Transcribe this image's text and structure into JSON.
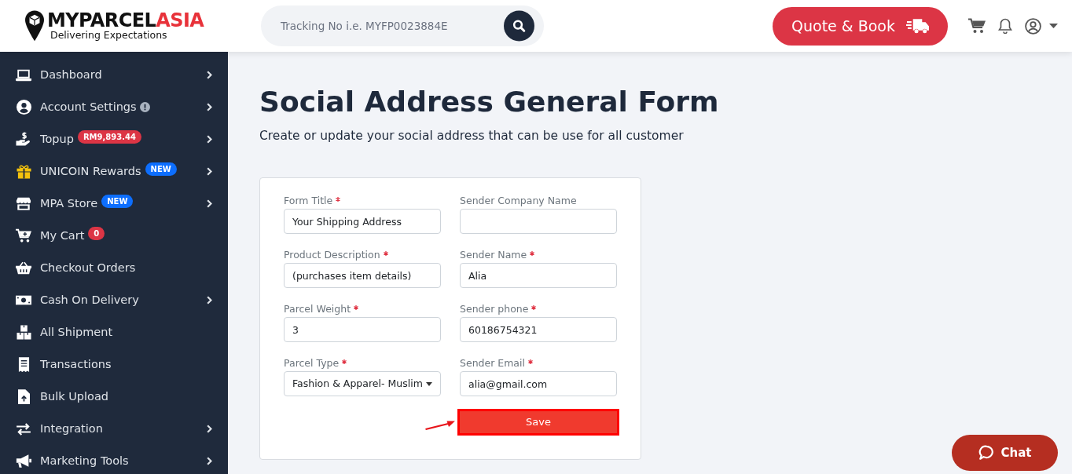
{
  "header": {
    "logo": {
      "wordmark": "MYPARCEL",
      "wordmark_accent": "ASIA",
      "tagline": "Delivering Expectations"
    },
    "search": {
      "placeholder": "Tracking No i.e. MYFP0023884E"
    },
    "quote_button": "Quote & Book"
  },
  "sidebar": {
    "items": [
      {
        "label": "Dashboard",
        "notice": false,
        "expandable": true
      },
      {
        "label": "Account Settings",
        "notice": true,
        "expandable": true
      },
      {
        "label": "Topup",
        "notice": false,
        "expandable": true,
        "badge": {
          "text": "RM9,893.44",
          "color": "#dc3545"
        }
      },
      {
        "label": "UNICOIN Rewards",
        "notice": false,
        "expandable": true,
        "badge": {
          "text": "NEW",
          "color": "#0d6efd"
        }
      },
      {
        "label": "MPA Store",
        "notice": false,
        "expandable": true,
        "badge": {
          "text": "NEW",
          "color": "#0d6efd"
        }
      },
      {
        "label": "My Cart",
        "notice": false,
        "expandable": false,
        "badge": {
          "text": "0",
          "color": "#dc3545"
        }
      },
      {
        "label": "Checkout Orders",
        "notice": false,
        "expandable": false
      },
      {
        "label": "Cash On Delivery",
        "notice": false,
        "expandable": true
      },
      {
        "label": "All Shipment",
        "notice": false,
        "expandable": false
      },
      {
        "label": "Transactions",
        "notice": false,
        "expandable": false
      },
      {
        "label": "Bulk Upload",
        "notice": false,
        "expandable": false
      },
      {
        "label": "Integration",
        "notice": false,
        "expandable": true
      },
      {
        "label": "Marketing Tools",
        "notice": false,
        "expandable": true
      }
    ]
  },
  "page": {
    "title": "Social Address General Form",
    "subtitle": "Create or update your social address that can be use for all customer"
  },
  "form": {
    "fields": [
      {
        "label": "Form Title",
        "required": true,
        "kind": "text",
        "value": "Your Shipping Address"
      },
      {
        "label": "Sender Company Name",
        "required": false,
        "kind": "text"
      },
      {
        "label": "Product Description",
        "required": true,
        "kind": "text",
        "value": "(purchases item details)"
      },
      {
        "label": "Sender Name",
        "required": true,
        "kind": "text",
        "value": "Alia"
      },
      {
        "label": "Parcel Weight",
        "required": true,
        "kind": "text",
        "value": "3"
      },
      {
        "label": "Sender phone",
        "required": true,
        "kind": "text",
        "value": "60186754321"
      },
      {
        "label": "Parcel Type",
        "required": true,
        "kind": "select",
        "value": "Fashion & Apparel- Muslim"
      },
      {
        "label": "Sender Email",
        "required": true,
        "kind": "text",
        "value": "alia@gmail.com"
      }
    ],
    "save_button": {
      "label": "Save",
      "highlighted": true
    }
  },
  "chat_button": "Chat"
}
